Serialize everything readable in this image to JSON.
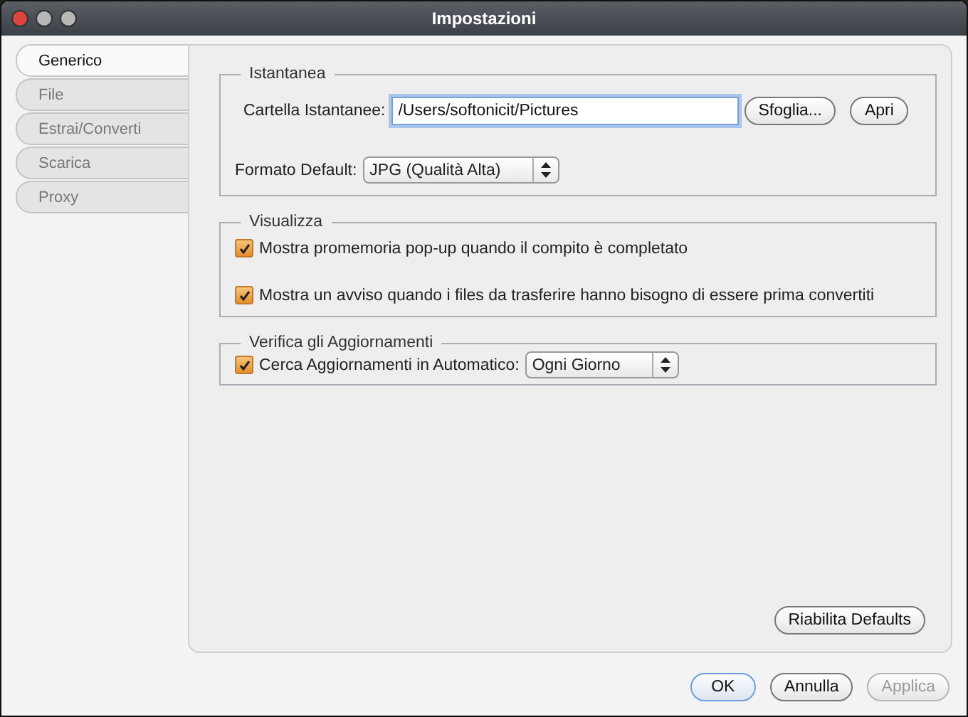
{
  "window": {
    "title": "Impostazioni"
  },
  "tabs": [
    {
      "label": "Generico",
      "selected": true
    },
    {
      "label": "File",
      "selected": false
    },
    {
      "label": "Estrai/Converti",
      "selected": false
    },
    {
      "label": "Scarica",
      "selected": false
    },
    {
      "label": "Proxy",
      "selected": false
    }
  ],
  "snapshot": {
    "title": "Istantanea",
    "folder_label": "Cartella Istantanee:",
    "folder_value": "/Users/softonicit/Pictures",
    "buttons": [
      "Sfoglia...",
      "Apri"
    ],
    "format_label": "Formato Default:",
    "format_value": "JPG (Qualità Alta)"
  },
  "display": {
    "title": "Visualizza",
    "options": [
      {
        "label": "Mostra promemoria pop-up quando il compito è completato",
        "checked": true
      },
      {
        "label": "Mostra un avviso quando i files da trasferire hanno bisogno di essere prima convertiti",
        "checked": true
      }
    ]
  },
  "updates": {
    "title": "Verifica gli Aggiornamenti",
    "auto_check": {
      "label": "Cerca Aggiornamenti in Automatico:",
      "checked": true
    },
    "frequency": "Ogni Giorno"
  },
  "restore_button": "Riabilita Defaults",
  "dialog_buttons": [
    {
      "label": "OK",
      "default": true,
      "disabled": false
    },
    {
      "label": "Annulla",
      "default": false,
      "disabled": false
    },
    {
      "label": "Applica",
      "default": false,
      "disabled": true
    }
  ]
}
